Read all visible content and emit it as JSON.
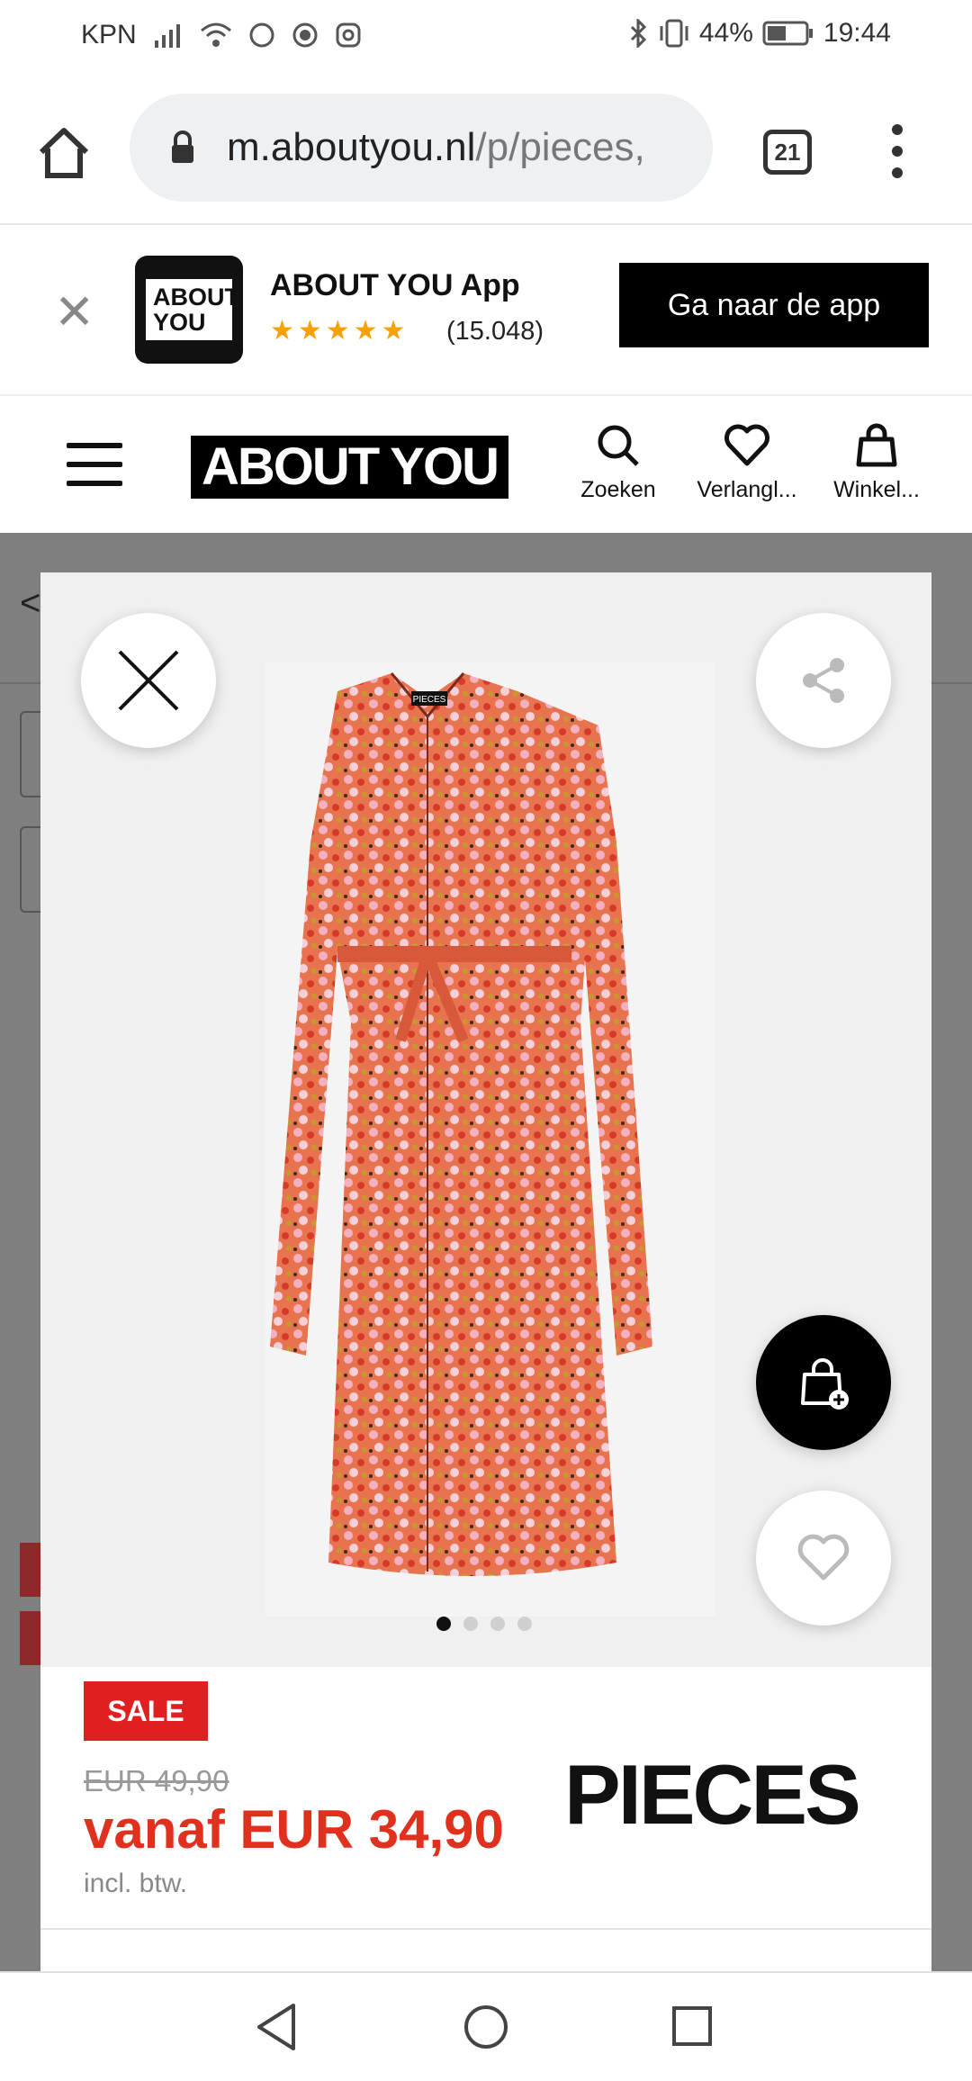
{
  "status_bar": {
    "carrier": "KPN",
    "battery": "44%",
    "time": "19:44"
  },
  "browser": {
    "url_host": "m.aboutyou.nl",
    "url_path": "/p/pieces,",
    "tab_count": "21"
  },
  "app_banner": {
    "title": "ABOUT YOU App",
    "logo_text": "ABOUT YOU",
    "rating_stars": 5,
    "rating_count": "(15.048)",
    "cta_label": "Ga naar de app"
  },
  "site_header": {
    "brand": "ABOUT YOU",
    "nav": [
      {
        "label": "Zoeken",
        "icon": "search-icon"
      },
      {
        "label": "Verlangl...",
        "icon": "heart-icon"
      },
      {
        "label": "Winkel...",
        "icon": "shopping-bag-icon"
      }
    ]
  },
  "product": {
    "image_count": 4,
    "active_image": 1,
    "badge": "SALE",
    "old_price": "EUR 49,90",
    "price": "vanaf EUR 34,90",
    "vat_note": "incl. btw.",
    "brand": "PIECES",
    "garment_label": "PIECES",
    "colors": {
      "sale": "#e02020",
      "price": "#e0301e"
    }
  }
}
